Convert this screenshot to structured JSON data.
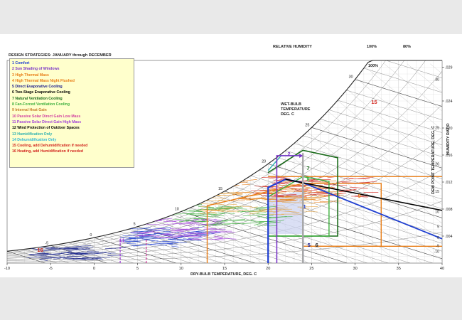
{
  "chart_data": {
    "type": "psychrometric",
    "legend_title": "DESIGN STRATEGIES:  JANUARY through DECEMBER",
    "strategies": [
      {
        "id": 1,
        "label": "1 Comfort",
        "color": "#1f3fd0"
      },
      {
        "id": 2,
        "label": "2 Sun Shading of Windows",
        "color": "#7a35c8"
      },
      {
        "id": 3,
        "label": "3 High Thermal Mass",
        "color": "#e87d16"
      },
      {
        "id": 4,
        "label": "4 High Thermal Mass Night Flushed",
        "color": "#e87d16"
      },
      {
        "id": 5,
        "label": "5 Direct Evaporative Cooling",
        "color": "#1a1a8c"
      },
      {
        "id": 6,
        "label": "6 Two-Stage Evaporative Cooling",
        "color": "#000000"
      },
      {
        "id": 7,
        "label": "7 Natural Ventilation Cooling",
        "color": "#1a6b1a"
      },
      {
        "id": 8,
        "label": "8 Fan-Forced Ventilation Cooling",
        "color": "#3fb03f"
      },
      {
        "id": 9,
        "label": "9 Internal Heat Gain",
        "color": "#c57a2a"
      },
      {
        "id": 10,
        "label": "10 Passive Solar Direct Gain Low Mass",
        "color": "#d23fa0"
      },
      {
        "id": 11,
        "label": "11 Passive Solar Direct Gain High Mass",
        "color": "#a03fd8"
      },
      {
        "id": 12,
        "label": "12 Wind Protection of Outdoor Spaces",
        "color": "#000000"
      },
      {
        "id": 13,
        "label": "13 Humidification Only",
        "color": "#2bb0b0"
      },
      {
        "id": 14,
        "label": "14 Dehumidification Only",
        "color": "#36b8d8"
      },
      {
        "id": 15,
        "label": "15 Cooling, add Dehumidification if needed",
        "color": "#d2261f"
      },
      {
        "id": 16,
        "label": "16 Heating, add Humidification if needed",
        "color": "#d2261f"
      }
    ],
    "xlabel": "DRY-BULB TEMPERATURE, DEG. C",
    "xlim": [
      -10,
      40
    ],
    "x_ticks": [
      "-10",
      "-5",
      "0",
      "5",
      "10",
      "15",
      "20",
      "25",
      "30",
      "35",
      "40"
    ],
    "ylabel": "HUMIDITY RATIO",
    "ylim": [
      0,
      0.03
    ],
    "y_ticks": [
      ".004",
      ".008",
      ".012",
      ".016",
      ".020",
      ".024",
      ".029"
    ],
    "y_tick_values": [
      0.004,
      0.008,
      0.012,
      0.016,
      0.02,
      0.024,
      0.029
    ],
    "dew_point_label": "DEW POINT TEMPERATURE, DEG. C",
    "dew_point_ticks": [
      "30",
      "25",
      "20",
      "15",
      "10",
      "5",
      "0",
      "-5",
      "-10"
    ],
    "dew_point_values": [
      30,
      25,
      20,
      15,
      10,
      5,
      0,
      -5,
      -10
    ],
    "wet_bulb_label": [
      "WET-BULB",
      "TEMPERATURE",
      "DEG. C"
    ],
    "wet_bulb_ticks": [
      "-5",
      "0",
      "5",
      "10",
      "15",
      "20",
      "25",
      "30"
    ],
    "wet_bulb_values": [
      -5,
      0,
      5,
      10,
      15,
      20,
      25,
      30
    ],
    "rh_label": "RELATIVE HUMIDITY",
    "rh_top_labels": [
      "100%",
      "80%"
    ],
    "zone_labels": [
      {
        "text": "1",
        "color": "#1f3fd0",
        "x": 24.2,
        "w": 0.0081
      },
      {
        "text": "2",
        "color": "#7a35c8",
        "x": 22.4,
        "w": 0.0159
      },
      {
        "text": "5",
        "color": "#1a1a8c",
        "x": 24.7,
        "w": 0.0024
      },
      {
        "text": "6",
        "color": "#1a1a1a",
        "x": 25.6,
        "w": 0.0024
      },
      {
        "text": "7",
        "color": "#1a6b1a",
        "x": 24.6,
        "w": 0.0138
      },
      {
        "text": "8",
        "color": "#3fb03f",
        "x": 24.6,
        "w": 0.0121
      },
      {
        "text": "9",
        "color": "#e87d16",
        "x": 30.5,
        "w": 0.0097
      },
      {
        "text": "11",
        "color": "#a03fd8",
        "x": 3.2,
        "w": 0.0031
      },
      {
        "text": "15",
        "color": "#d2261f",
        "x": 32.2,
        "w": 0.0236
      },
      {
        "text": "16",
        "color": "#d2261f",
        "x": -6.2,
        "w": 0.0017
      }
    ],
    "zones": [
      {
        "id": "orange-thermal-mass",
        "color": "#e87d16",
        "width": 1.4,
        "points": [
          [
            13,
            0
          ],
          [
            13,
            0.0085
          ],
          [
            24,
            0.0118
          ],
          [
            33,
            0.0118
          ],
          [
            33,
            0.0025
          ],
          [
            24,
            0.0025
          ],
          [
            24,
            0
          ]
        ]
      },
      {
        "id": "orange-night-flush",
        "color": "#e87d16",
        "width": 1.3,
        "points": [
          [
            20,
            0.0128
          ],
          [
            40,
            0.0128
          ]
        ]
      },
      {
        "id": "orange-internal",
        "color": "#e87d16",
        "width": 1.3,
        "points": [
          [
            24,
            0.0025
          ],
          [
            40,
            0.0025
          ]
        ]
      },
      {
        "id": "green-natural-vent",
        "color": "#1a6b1a",
        "width": 1.6,
        "points": [
          [
            20,
            0.0134
          ],
          [
            24,
            0.0167
          ],
          [
            28,
            0.0156
          ],
          [
            28,
            0.004
          ],
          [
            20,
            0.004
          ]
        ]
      },
      {
        "id": "green-fan-vent",
        "color": "#3fb03f",
        "width": 1.4,
        "points": [
          [
            20,
            0.0098
          ],
          [
            24,
            0.0128
          ],
          [
            27,
            0.0121
          ],
          [
            27,
            0.004
          ],
          [
            20,
            0.004
          ]
        ]
      },
      {
        "id": "blue-comfort",
        "color": "#1f3fd0",
        "width": 2.2,
        "points": [
          [
            20,
            0
          ],
          [
            20,
            0.0112
          ],
          [
            22,
            0.0124
          ],
          [
            24,
            0.0119
          ],
          [
            24,
            0
          ]
        ]
      },
      {
        "id": "blue-evap",
        "color": "#1f3fd0",
        "width": 1.8,
        "points": [
          [
            24,
            0.0119
          ],
          [
            40,
            0.0036
          ]
        ]
      },
      {
        "id": "black-two-stage",
        "color": "#000000",
        "width": 1.6,
        "points": [
          [
            22,
            0.0124
          ],
          [
            40,
            0.0078
          ]
        ]
      },
      {
        "id": "cyan-dehum",
        "color": "#2bb0b0",
        "width": 1.4,
        "points": [
          [
            20,
            0.0137
          ],
          [
            21.5,
            0.0159
          ],
          [
            24,
            0.0159
          ]
        ]
      },
      {
        "id": "purple-shading",
        "color": "#7a35c8",
        "width": 1.6,
        "points": [
          [
            21,
            0
          ],
          [
            21,
            0.0159
          ],
          [
            24,
            0.0159
          ]
        ]
      },
      {
        "id": "purple-solar-11",
        "color": "#a03fd8",
        "width": 1.3,
        "dash": "3,2",
        "points": [
          [
            3,
            0
          ],
          [
            3,
            0.0035
          ]
        ]
      },
      {
        "id": "pink-solar-10",
        "color": "#d23fa0",
        "width": 1.3,
        "dash": "3,2",
        "points": [
          [
            6,
            0
          ],
          [
            6,
            0.0035
          ]
        ]
      },
      {
        "id": "gray-wetbulb-marker",
        "color": "#a8a8a8",
        "width": 2.4,
        "points": [
          [
            24,
            0.0163
          ],
          [
            24,
            0
          ]
        ]
      }
    ],
    "shaded_comfort": [
      [
        20,
        0.0043
      ],
      [
        20,
        0.0098
      ],
      [
        24,
        0.0107
      ],
      [
        24,
        0.0043
      ]
    ],
    "climate_hours": [
      {
        "t_lo": -8,
        "t_hi": 2,
        "w_lo": 0.0005,
        "w_hi": 0.0024,
        "color": "#202a8f"
      },
      {
        "t_lo": 3,
        "t_hi": 12,
        "w_lo": 0.0025,
        "w_hi": 0.0052,
        "color": "#1f3fd0"
      },
      {
        "t_lo": 4,
        "t_hi": 14,
        "w_lo": 0.0035,
        "w_hi": 0.0065,
        "color": "#a03fd8"
      },
      {
        "t_lo": 9,
        "t_hi": 20,
        "w_lo": 0.0055,
        "w_hi": 0.0085,
        "color": "#3fb03f"
      },
      {
        "t_lo": 12,
        "t_hi": 24,
        "w_lo": 0.0072,
        "w_hi": 0.0105,
        "color": "#e8a84a"
      },
      {
        "t_lo": 15,
        "t_hi": 26,
        "w_lo": 0.009,
        "w_hi": 0.0123,
        "color": "#e87d16"
      },
      {
        "t_lo": 18,
        "t_hi": 31,
        "w_lo": 0.0098,
        "w_hi": 0.0128,
        "color": "#d2261f"
      }
    ]
  }
}
